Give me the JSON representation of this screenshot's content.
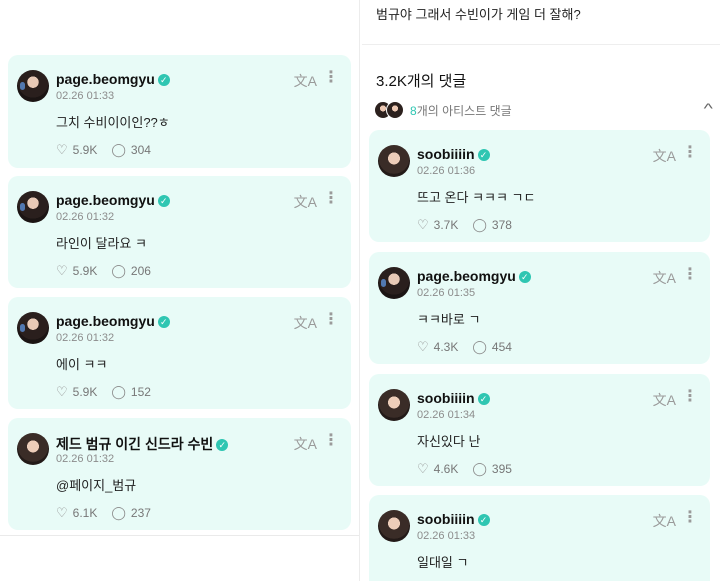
{
  "left_comments": [
    {
      "name": "page.beomgyu",
      "time": "02.26 01:33",
      "text": "그치 수비이이인??ㅎ",
      "likes": "5.9K",
      "replies": "304"
    },
    {
      "name": "page.beomgyu",
      "time": "02.26 01:32",
      "text": "라인이 달라요 ㅋ",
      "likes": "5.9K",
      "replies": "206"
    },
    {
      "name": "page.beomgyu",
      "time": "02.26 01:32",
      "text": "에이 ㅋㅋ",
      "likes": "5.9K",
      "replies": "152"
    },
    {
      "name": "제드 범규 이긴 신드라 수빈",
      "time": "02.26 01:32",
      "text": "@페이지_범규",
      "likes": "6.1K",
      "replies": "237"
    }
  ],
  "right_header": {
    "question": "범규야 그래서 수빈이가 게임 더 잘해?",
    "comments_count": "3.2K개의 댓글",
    "artist_count": "8",
    "artist_label": "개의 아티스트 댓글"
  },
  "right_comments": [
    {
      "name": "soobiiiin",
      "time": "02.26 01:36",
      "text": "뜨고 온다 ㅋㅋㅋ ㄱㄷ",
      "likes": "3.7K",
      "replies": "378"
    },
    {
      "name": "page.beomgyu",
      "time": "02.26 01:35",
      "text": "ㅋㅋ바로 ㄱ",
      "likes": "4.3K",
      "replies": "454"
    },
    {
      "name": "soobiiiin",
      "time": "02.26 01:34",
      "text": "자신있다 난",
      "likes": "4.6K",
      "replies": "395"
    },
    {
      "name": "soobiiiin",
      "time": "02.26 01:33",
      "text": "일대일 ㄱ"
    }
  ],
  "icons": {
    "translate": "translate-icon",
    "more": "more-vertical-icon",
    "like": "like-icon",
    "reply": "reply-bubble-icon",
    "verified": "verified-badge-icon",
    "collapse": "chevron-up-icon"
  },
  "colors": {
    "card_bg": "#e8fbf7",
    "accent": "#2fc6b2"
  }
}
